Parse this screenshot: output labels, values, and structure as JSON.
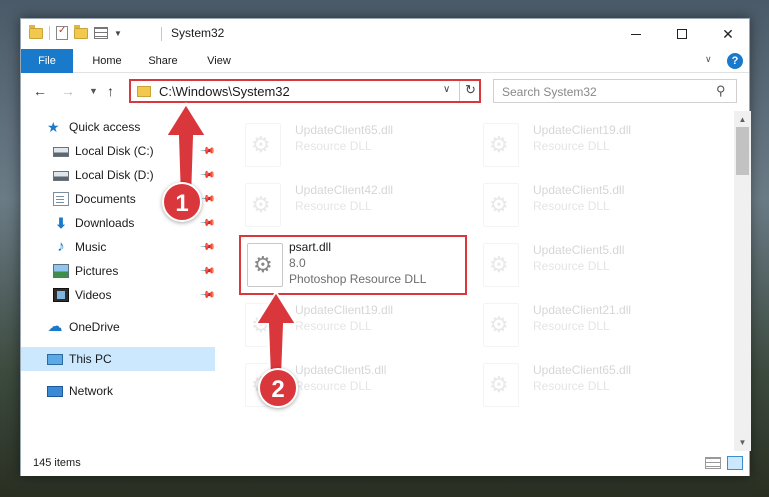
{
  "window": {
    "title": "System32",
    "controls": {
      "minimize": "–",
      "maximize": "□",
      "close": "✕"
    }
  },
  "ribbon": {
    "tabs": [
      "File",
      "Home",
      "Share",
      "View"
    ],
    "help": "?"
  },
  "address_bar": {
    "path": "C:\\Windows\\System32",
    "search_placeholder": "Search System32"
  },
  "nav_pane": {
    "items": [
      {
        "label": "Quick access",
        "icon": "star-icon",
        "pinned": false
      },
      {
        "label": "Local Disk (C:)",
        "icon": "drive-icon",
        "pinned": true
      },
      {
        "label": "Local Disk (D:)",
        "icon": "drive-icon",
        "pinned": true
      },
      {
        "label": "Documents",
        "icon": "documents-icon",
        "pinned": true
      },
      {
        "label": "Downloads",
        "icon": "downloads-icon",
        "pinned": true
      },
      {
        "label": "Music",
        "icon": "music-icon",
        "pinned": true
      },
      {
        "label": "Pictures",
        "icon": "pictures-icon",
        "pinned": true
      },
      {
        "label": "Videos",
        "icon": "videos-icon",
        "pinned": true
      },
      {
        "label": "OneDrive",
        "icon": "onedrive-icon",
        "pinned": false
      },
      {
        "label": "This PC",
        "icon": "this-pc-icon",
        "pinned": false,
        "selected": true
      },
      {
        "label": "Network",
        "icon": "network-icon",
        "pinned": false
      }
    ]
  },
  "files": [
    {
      "name": "UpdateClient65.dll",
      "type": "Resource DLL",
      "faded": true
    },
    {
      "name": "UpdateClient19.dll",
      "type": "Resource DLL",
      "faded": true
    },
    {
      "name": "UpdateClient42.dll",
      "type": "Resource DLL",
      "faded": true
    },
    {
      "name": "UpdateClient5.dll",
      "type": "Resource DLL",
      "faded": true
    },
    {
      "name": "psart.dll",
      "version": "8.0",
      "type": "Photoshop Resource DLL",
      "faded": false,
      "highlighted": true
    },
    {
      "name": "UpdateClient5.dll",
      "type": "Resource DLL",
      "faded": true
    },
    {
      "name": "UpdateClient19.dll",
      "type": "Resource DLL",
      "faded": true
    },
    {
      "name": "UpdateClient21.dll",
      "type": "Resource DLL",
      "faded": true
    },
    {
      "name": "UpdateClient5.dll",
      "type": "Resource DLL",
      "faded": true
    },
    {
      "name": "UpdateClient65.dll",
      "type": "Resource DLL",
      "faded": true
    }
  ],
  "status": {
    "item_count": "145 items"
  },
  "callouts": [
    "1",
    "2"
  ],
  "colors": {
    "accent": "#1979ca",
    "callout_red": "#d9373b",
    "selection": "#cce8ff"
  }
}
